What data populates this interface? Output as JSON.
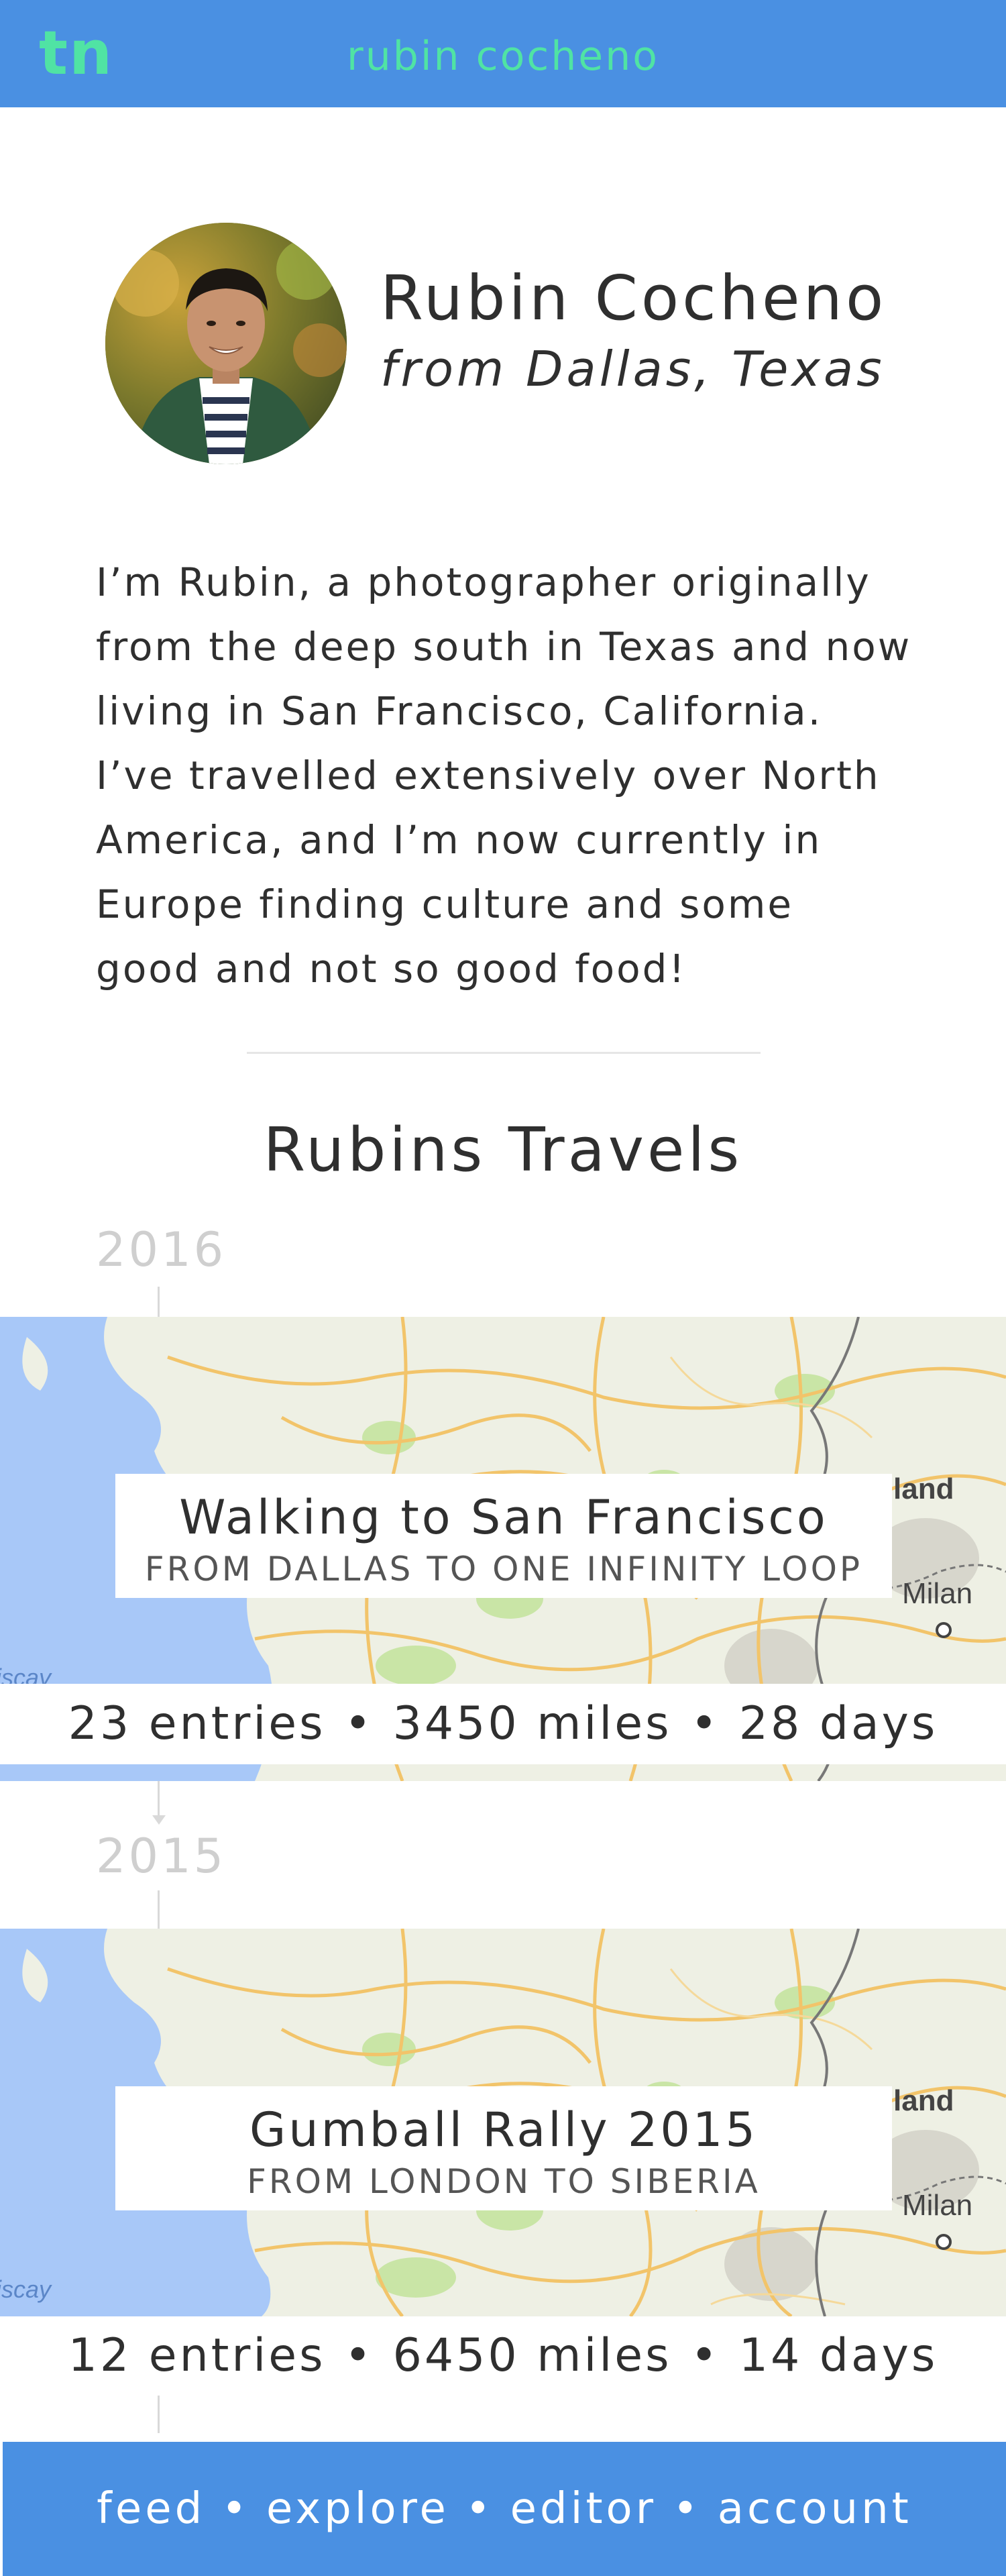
{
  "header": {
    "logo": "tn",
    "title": "rubin cocheno"
  },
  "profile": {
    "name": "Rubin Cocheno",
    "from": "from Dallas, Texas",
    "bio_lines": [
      "I’m Rubin, a photographer originally",
      "from the deep south in Texas and now",
      "living in San Francisco, California.",
      "I’ve travelled extensively over North",
      "America, and I’m now currently in",
      "Europe finding culture and some",
      "good and not so good food!"
    ]
  },
  "travels": {
    "title": "Rubins Travels",
    "trips": [
      {
        "year": "2016",
        "title": "Walking to San Francisco",
        "subtitle": "FROM DALLAS TO ONE INFINITY LOOP",
        "entries": "23 entries",
        "miles": "3450 miles",
        "days": "28 days",
        "map_labels": [
          "land",
          "Milan",
          "Biscay"
        ]
      },
      {
        "year": "2015",
        "title": "Gumball Rally 2015",
        "subtitle": "FROM LONDON TO SIBERIA",
        "entries": "12 entries",
        "miles": "6450 miles",
        "days": "14 days",
        "map_labels": [
          "land",
          "Milan",
          "Biscay"
        ]
      }
    ]
  },
  "separator": "•",
  "nav": {
    "items": [
      "feed",
      "explore",
      "editor",
      "account"
    ]
  },
  "colors": {
    "brand_blue": "#4a90e2",
    "accent_green": "#50e3a4"
  }
}
